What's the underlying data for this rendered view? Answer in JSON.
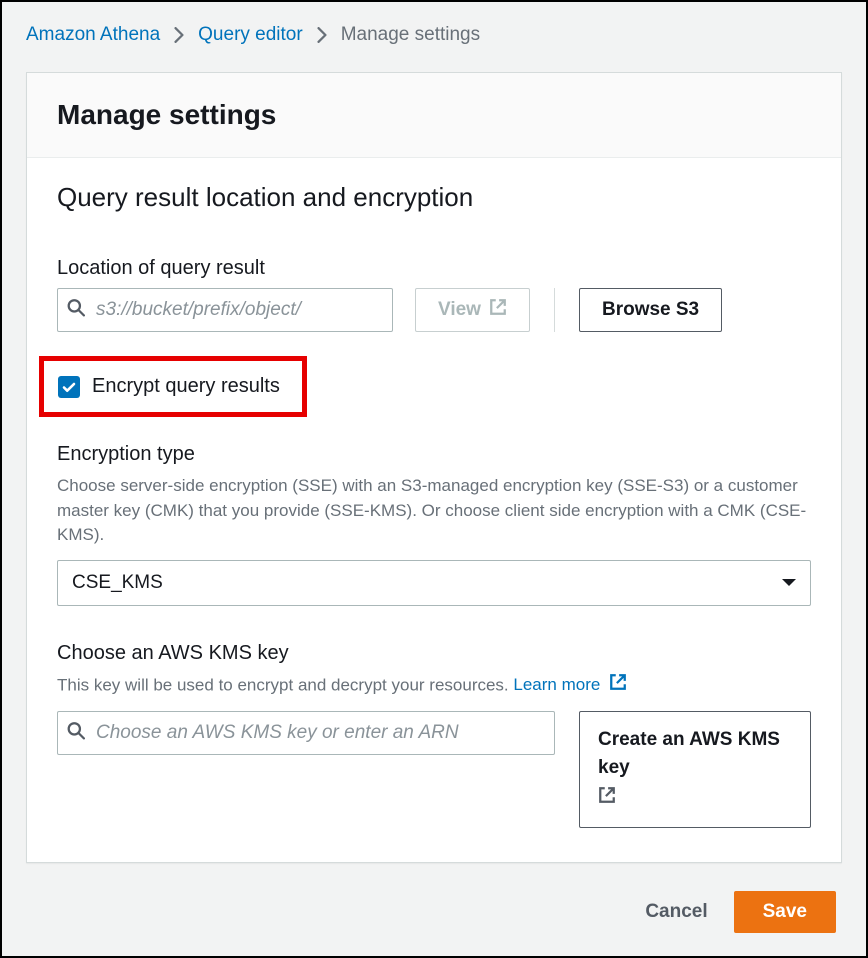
{
  "breadcrumb": {
    "items": [
      "Amazon Athena",
      "Query editor",
      "Manage settings"
    ]
  },
  "card": {
    "title": "Manage settings",
    "section_title": "Query result location and encryption",
    "location": {
      "label": "Location of query result",
      "placeholder": "s3://bucket/prefix/object/",
      "value": "",
      "view_label": "View",
      "browse_label": "Browse S3"
    },
    "encrypt_checkbox": {
      "checked": true,
      "label": "Encrypt query results"
    },
    "encryption_type": {
      "label": "Encryption type",
      "description": "Choose server-side encryption (SSE) with an S3-managed encryption key (SSE-S3) or a customer master key (CMK) that you provide (SSE-KMS). Or choose client side encryption with a CMK (CSE-KMS).",
      "value": "CSE_KMS"
    },
    "kms_key": {
      "label": "Choose an AWS KMS key",
      "description_prefix": "This key will be used to encrypt and decrypt your resources. ",
      "learn_more": "Learn more",
      "placeholder": "Choose an AWS KMS key or enter an ARN",
      "value": "",
      "create_label": "Create an AWS KMS key"
    }
  },
  "footer": {
    "cancel": "Cancel",
    "save": "Save"
  }
}
